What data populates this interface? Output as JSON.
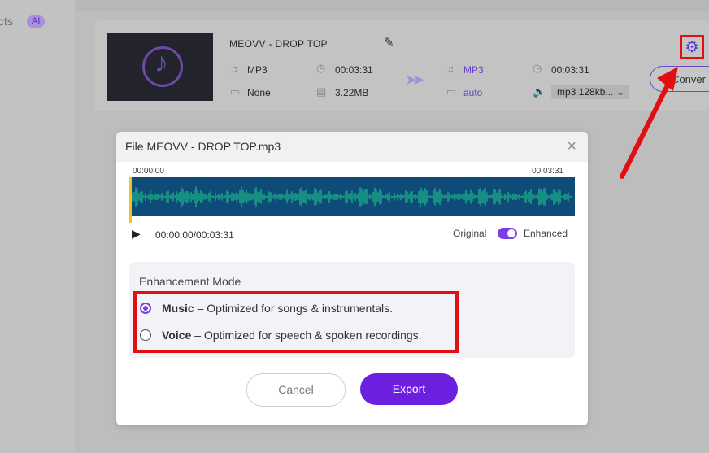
{
  "sidebar": {
    "partial_text": "cts",
    "badge": "AI"
  },
  "file": {
    "title": "MEOVV - DROP TOP",
    "source": {
      "format": "MP3",
      "duration": "00:03:31",
      "extra": "None",
      "size": "3.22MB"
    },
    "target": {
      "format": "MP3",
      "duration": "00:03:31",
      "extra": "auto",
      "quality": "mp3 128kb..."
    }
  },
  "actions": {
    "convert_label": "Conver"
  },
  "dialog": {
    "title": "File MEOVV - DROP TOP.mp3",
    "waveform": {
      "start_time": "00:00:00",
      "end_time": "00:03:31"
    },
    "player": {
      "time": "00:00:00/00:03:31"
    },
    "toggle": {
      "left": "Original",
      "right": "Enhanced",
      "enabled": true
    },
    "mode": {
      "heading": "Enhancement Mode",
      "options": [
        {
          "name": "Music",
          "desc": "– Optimized for songs & instrumentals.",
          "selected": true
        },
        {
          "name": "Voice",
          "desc": "– Optimized for speech & spoken recordings.",
          "selected": false
        }
      ]
    },
    "buttons": {
      "cancel": "Cancel",
      "export": "Export"
    }
  },
  "colors": {
    "accent": "#6d1fe0",
    "highlight": "#e20f12",
    "wave": "#1fd08a",
    "wave_bg": "#0e4b78"
  }
}
